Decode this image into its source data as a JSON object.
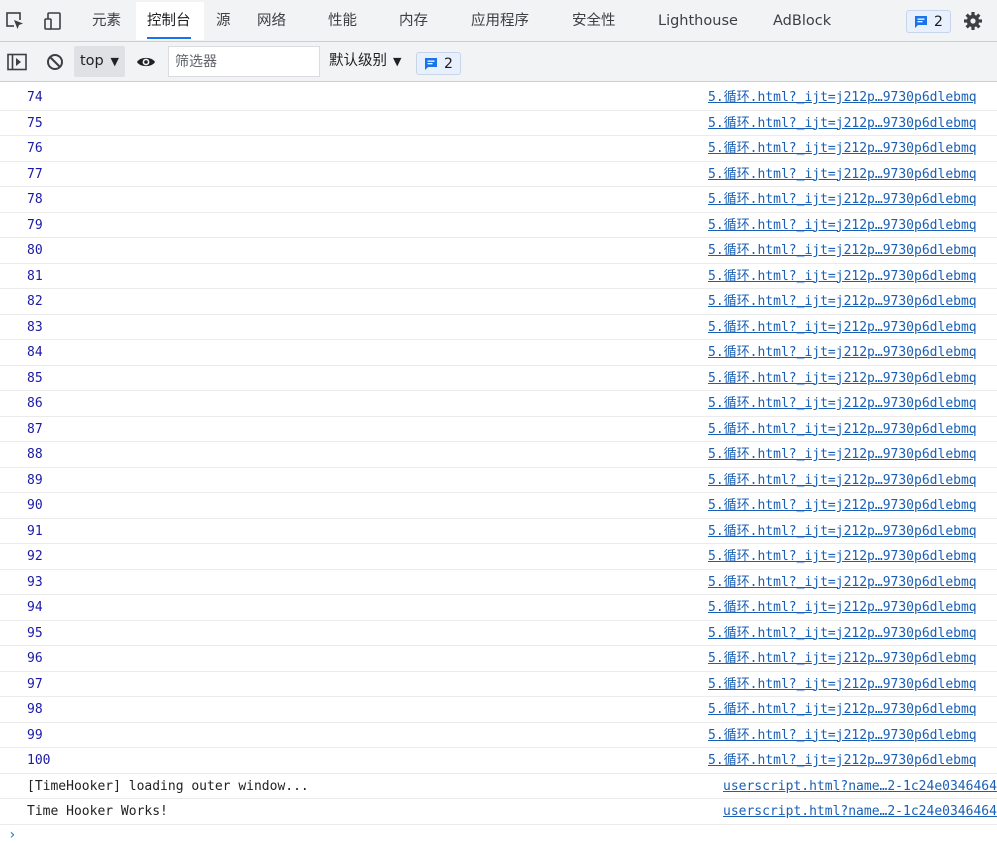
{
  "tabs": [
    {
      "label": "元素"
    },
    {
      "label": "控制台"
    },
    {
      "label": "源"
    },
    {
      "label": "网络"
    },
    {
      "label": "性能"
    },
    {
      "label": "内存"
    },
    {
      "label": "应用程序"
    },
    {
      "label": "安全性"
    },
    {
      "label": "Lighthouse"
    },
    {
      "label": "AdBlock"
    }
  ],
  "header": {
    "issues_count": "2"
  },
  "toolbar": {
    "context": "top",
    "filter_placeholder": "筛选器",
    "level_label": "默认级别",
    "issues_count": "2"
  },
  "console": {
    "number_rows": [
      {
        "value": "74",
        "source": "5.循环.html?_ijt=j212p…9730p6dlebmq"
      },
      {
        "value": "75",
        "source": "5.循环.html?_ijt=j212p…9730p6dlebmq"
      },
      {
        "value": "76",
        "source": "5.循环.html?_ijt=j212p…9730p6dlebmq"
      },
      {
        "value": "77",
        "source": "5.循环.html?_ijt=j212p…9730p6dlebmq"
      },
      {
        "value": "78",
        "source": "5.循环.html?_ijt=j212p…9730p6dlebmq"
      },
      {
        "value": "79",
        "source": "5.循环.html?_ijt=j212p…9730p6dlebmq"
      },
      {
        "value": "80",
        "source": "5.循环.html?_ijt=j212p…9730p6dlebmq"
      },
      {
        "value": "81",
        "source": "5.循环.html?_ijt=j212p…9730p6dlebmq"
      },
      {
        "value": "82",
        "source": "5.循环.html?_ijt=j212p…9730p6dlebmq"
      },
      {
        "value": "83",
        "source": "5.循环.html?_ijt=j212p…9730p6dlebmq"
      },
      {
        "value": "84",
        "source": "5.循环.html?_ijt=j212p…9730p6dlebmq"
      },
      {
        "value": "85",
        "source": "5.循环.html?_ijt=j212p…9730p6dlebmq"
      },
      {
        "value": "86",
        "source": "5.循环.html?_ijt=j212p…9730p6dlebmq"
      },
      {
        "value": "87",
        "source": "5.循环.html?_ijt=j212p…9730p6dlebmq"
      },
      {
        "value": "88",
        "source": "5.循环.html?_ijt=j212p…9730p6dlebmq"
      },
      {
        "value": "89",
        "source": "5.循环.html?_ijt=j212p…9730p6dlebmq"
      },
      {
        "value": "90",
        "source": "5.循环.html?_ijt=j212p…9730p6dlebmq"
      },
      {
        "value": "91",
        "source": "5.循环.html?_ijt=j212p…9730p6dlebmq"
      },
      {
        "value": "92",
        "source": "5.循环.html?_ijt=j212p…9730p6dlebmq"
      },
      {
        "value": "93",
        "source": "5.循环.html?_ijt=j212p…9730p6dlebmq"
      },
      {
        "value": "94",
        "source": "5.循环.html?_ijt=j212p…9730p6dlebmq"
      },
      {
        "value": "95",
        "source": "5.循环.html?_ijt=j212p…9730p6dlebmq"
      },
      {
        "value": "96",
        "source": "5.循环.html?_ijt=j212p…9730p6dlebmq"
      },
      {
        "value": "97",
        "source": "5.循环.html?_ijt=j212p…9730p6dlebmq"
      },
      {
        "value": "98",
        "source": "5.循环.html?_ijt=j212p…9730p6dlebmq"
      },
      {
        "value": "99",
        "source": "5.循环.html?_ijt=j212p…9730p6dlebmq"
      },
      {
        "value": "100",
        "source": "5.循环.html?_ijt=j212p…9730p6dlebmq"
      }
    ],
    "text_rows": [
      {
        "message": "[TimeHooker] loading outer window...",
        "source": "userscript.html?name…2-1c24e0346464"
      },
      {
        "message": "Time Hooker Works!",
        "source": "userscript.html?name…2-1c24e0346464"
      }
    ],
    "prompt_glyph": "›"
  },
  "icons": {
    "inspect": "inspect-element-icon",
    "device": "device-toolbar-icon",
    "settings": "gear-icon",
    "sidebar": "sidebar-toggle-icon",
    "clear": "clear-console-icon",
    "eye": "live-expression-eye-icon",
    "issue": "issue-chat-icon"
  },
  "colors": {
    "accent": "#1a73e8",
    "number_text": "#1a1aa6",
    "link": "#1a5fb4",
    "toolbar_bg": "#f1f3f4"
  }
}
